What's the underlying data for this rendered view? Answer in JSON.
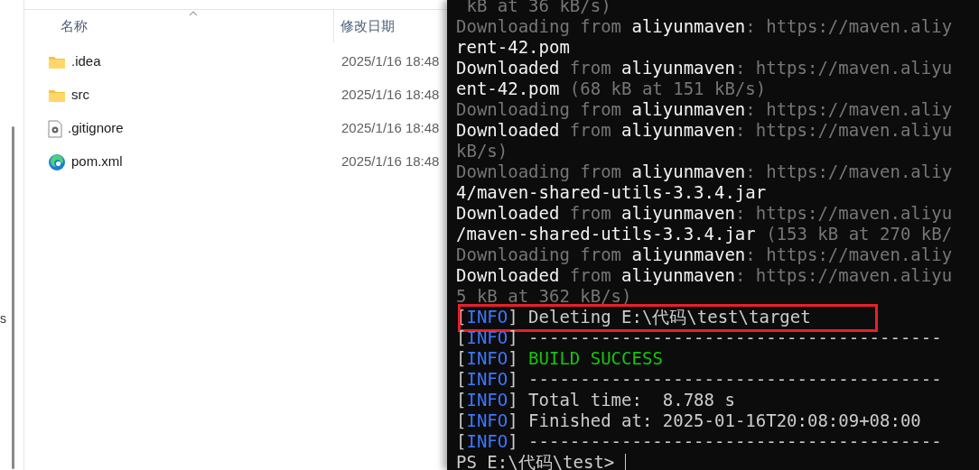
{
  "explorer": {
    "nav_text": "s",
    "columns": [
      {
        "label": "名称",
        "sorted": true
      },
      {
        "label": "修改日期",
        "sorted": false
      }
    ],
    "files": [
      {
        "kind": "folder",
        "name": ".idea",
        "date": "2025/1/16 18:48"
      },
      {
        "kind": "folder",
        "name": "src",
        "date": "2025/1/16 18:48"
      },
      {
        "kind": "config",
        "name": ".gitignore",
        "date": "2025/1/16 18:48"
      },
      {
        "kind": "browser",
        "name": "pom.xml",
        "date": "2025/1/16 18:48"
      }
    ]
  },
  "terminal": {
    "lines": [
      {
        "highlighted": false,
        "segments": [
          {
            "kind": "dim",
            "text": " kB at 36 kB/s)"
          }
        ]
      },
      {
        "highlighted": false,
        "segments": [
          {
            "kind": "dim",
            "text": "Downloading from "
          },
          {
            "kind": "bright",
            "text": "aliyunmaven"
          },
          {
            "kind": "dim",
            "text": ": https://maven.aliy"
          }
        ]
      },
      {
        "highlighted": false,
        "segments": [
          {
            "kind": "bright",
            "text": "rent-42.pom"
          }
        ]
      },
      {
        "highlighted": false,
        "segments": [
          {
            "kind": "bright",
            "text": "Downloaded"
          },
          {
            "kind": "dim",
            "text": " from "
          },
          {
            "kind": "bright",
            "text": "aliyunmaven"
          },
          {
            "kind": "dim",
            "text": ": https://maven.aliyu"
          }
        ]
      },
      {
        "highlighted": false,
        "segments": [
          {
            "kind": "bright",
            "text": "ent-42.pom"
          },
          {
            "kind": "dim",
            "text": " (68 kB at 151 kB/s)"
          }
        ]
      },
      {
        "highlighted": false,
        "segments": [
          {
            "kind": "dim",
            "text": "Downloading from "
          },
          {
            "kind": "bright",
            "text": "aliyunmaven"
          },
          {
            "kind": "dim",
            "text": ": https://maven.aliy"
          }
        ]
      },
      {
        "highlighted": false,
        "segments": [
          {
            "kind": "bright",
            "text": "Downloaded"
          },
          {
            "kind": "dim",
            "text": " from "
          },
          {
            "kind": "bright",
            "text": "aliyunmaven"
          },
          {
            "kind": "dim",
            "text": ": https://maven.aliyu"
          }
        ]
      },
      {
        "highlighted": false,
        "segments": [
          {
            "kind": "dim",
            "text": "kB/s)"
          }
        ]
      },
      {
        "highlighted": false,
        "segments": [
          {
            "kind": "dim",
            "text": "Downloading from "
          },
          {
            "kind": "bright",
            "text": "aliyunmaven"
          },
          {
            "kind": "dim",
            "text": ": https://maven.aliy"
          }
        ]
      },
      {
        "highlighted": false,
        "segments": [
          {
            "kind": "bright",
            "text": "4/maven-shared-utils-3.3.4.jar"
          }
        ]
      },
      {
        "highlighted": false,
        "segments": [
          {
            "kind": "bright",
            "text": "Downloaded"
          },
          {
            "kind": "dim",
            "text": " from "
          },
          {
            "kind": "bright",
            "text": "aliyunmaven"
          },
          {
            "kind": "dim",
            "text": ": https://maven.aliyu"
          }
        ]
      },
      {
        "highlighted": false,
        "segments": [
          {
            "kind": "bright",
            "text": "/maven-shared-utils-3.3.4.jar"
          },
          {
            "kind": "dim",
            "text": " (153 kB at 270 kB/"
          }
        ]
      },
      {
        "highlighted": false,
        "segments": [
          {
            "kind": "dim",
            "text": "Downloading from "
          },
          {
            "kind": "bright",
            "text": "aliyunmaven"
          },
          {
            "kind": "dim",
            "text": ": https://maven.aliy"
          }
        ]
      },
      {
        "highlighted": false,
        "segments": [
          {
            "kind": "bright",
            "text": "Downloaded"
          },
          {
            "kind": "dim",
            "text": " from "
          },
          {
            "kind": "bright",
            "text": "aliyunmaven"
          },
          {
            "kind": "dim",
            "text": ": https://maven.aliyu"
          }
        ]
      },
      {
        "highlighted": false,
        "segments": [
          {
            "kind": "dim",
            "text": "5 kB at 362 kB/s)"
          }
        ]
      },
      {
        "highlighted": true,
        "segments": [
          {
            "kind": "normal",
            "text": "["
          },
          {
            "kind": "info",
            "text": "INFO"
          },
          {
            "kind": "normal",
            "text": "] Deleting E:\\代码\\test\\target"
          }
        ]
      },
      {
        "highlighted": false,
        "segments": [
          {
            "kind": "normal",
            "text": "["
          },
          {
            "kind": "info",
            "text": "INFO"
          },
          {
            "kind": "normal",
            "text": "] ----------------------------------------"
          }
        ]
      },
      {
        "highlighted": false,
        "segments": [
          {
            "kind": "normal",
            "text": "["
          },
          {
            "kind": "info",
            "text": "INFO"
          },
          {
            "kind": "normal",
            "text": "] "
          },
          {
            "kind": "success",
            "text": "BUILD SUCCESS"
          }
        ]
      },
      {
        "highlighted": false,
        "segments": [
          {
            "kind": "normal",
            "text": "["
          },
          {
            "kind": "info",
            "text": "INFO"
          },
          {
            "kind": "normal",
            "text": "] ----------------------------------------"
          }
        ]
      },
      {
        "highlighted": false,
        "segments": [
          {
            "kind": "normal",
            "text": "["
          },
          {
            "kind": "info",
            "text": "INFO"
          },
          {
            "kind": "normal",
            "text": "] Total time:  8.788 s"
          }
        ]
      },
      {
        "highlighted": false,
        "segments": [
          {
            "kind": "normal",
            "text": "["
          },
          {
            "kind": "info",
            "text": "INFO"
          },
          {
            "kind": "normal",
            "text": "] Finished at: 2025-01-16T20:08:09+08:00"
          }
        ]
      },
      {
        "highlighted": false,
        "segments": [
          {
            "kind": "normal",
            "text": "["
          },
          {
            "kind": "info",
            "text": "INFO"
          },
          {
            "kind": "normal",
            "text": "] ----------------------------------------"
          }
        ]
      }
    ],
    "prompt": {
      "text": "PS E:\\代码\\test>",
      "cursor": true
    }
  }
}
